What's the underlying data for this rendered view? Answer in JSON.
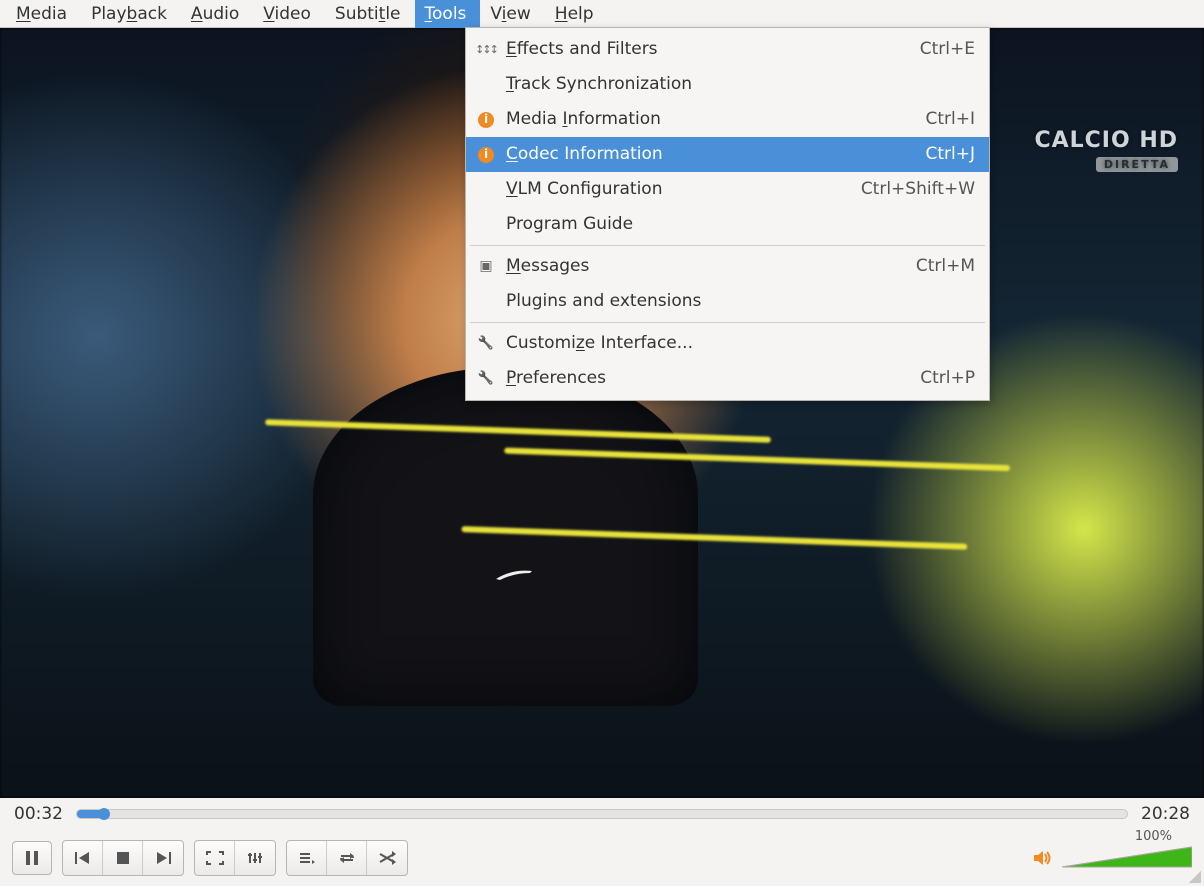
{
  "menubar": {
    "items": [
      {
        "label": "Media",
        "mnemonic_index": 0
      },
      {
        "label": "Playback",
        "mnemonic_index": 4
      },
      {
        "label": "Audio",
        "mnemonic_index": 0
      },
      {
        "label": "Video",
        "mnemonic_index": 0
      },
      {
        "label": "Subtitle",
        "mnemonic_index": 5
      },
      {
        "label": "Tools",
        "mnemonic_index": 0,
        "active": true
      },
      {
        "label": "View",
        "mnemonic_index": 1
      },
      {
        "label": "Help",
        "mnemonic_index": 0
      }
    ]
  },
  "tools_menu": {
    "items": [
      {
        "icon": "sliders",
        "label": "Effects and Filters",
        "mnemonic_index": 0,
        "shortcut": "Ctrl+E"
      },
      {
        "icon": "",
        "label": "Track Synchronization",
        "mnemonic_index": 0,
        "shortcut": ""
      },
      {
        "icon": "info",
        "label": "Media Information",
        "mnemonic_index": 6,
        "shortcut": "Ctrl+I"
      },
      {
        "icon": "info",
        "label": "Codec Information",
        "mnemonic_index": 0,
        "shortcut": "Ctrl+J",
        "highlight": true
      },
      {
        "icon": "",
        "label": "VLM Configuration",
        "mnemonic_index": 0,
        "shortcut": "Ctrl+Shift+W"
      },
      {
        "icon": "",
        "label": "Program Guide",
        "shortcut": ""
      },
      {
        "sep": true
      },
      {
        "icon": "msg",
        "label": "Messages",
        "mnemonic_index": 0,
        "shortcut": "Ctrl+M"
      },
      {
        "icon": "",
        "label": "Plugins and extensions",
        "shortcut": ""
      },
      {
        "sep": true
      },
      {
        "icon": "wrench",
        "label": "Customize Interface...",
        "mnemonic_index": 7,
        "shortcut": ""
      },
      {
        "icon": "wrench",
        "label": "Preferences",
        "mnemonic_index": 0,
        "shortcut": "Ctrl+P"
      }
    ]
  },
  "watermark": {
    "line1": "CALCIO HD",
    "line2": "DIRETTA"
  },
  "playback": {
    "elapsed": "00:32",
    "total": "20:28",
    "progress_pct": 2.6
  },
  "volume": {
    "label": "100%",
    "level_pct": 100
  }
}
